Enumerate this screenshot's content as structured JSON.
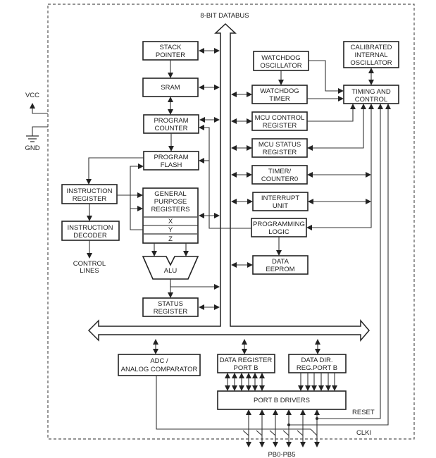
{
  "diagram": {
    "databus_label": "8-BIT DATABUS",
    "power": {
      "vcc": "VCC",
      "gnd": "GND"
    },
    "blocks": {
      "stack_pointer": [
        "STACK",
        "POINTER"
      ],
      "sram": [
        "SRAM"
      ],
      "program_counter": [
        "PROGRAM",
        "COUNTER"
      ],
      "program_flash": [
        "PROGRAM",
        "FLASH"
      ],
      "instruction_register": [
        "INSTRUCTION",
        "REGISTER"
      ],
      "instruction_decoder": [
        "INSTRUCTION",
        "DECODER"
      ],
      "control_lines": [
        "CONTROL",
        "LINES"
      ],
      "gp_registers": [
        "GENERAL",
        "PURPOSE",
        "REGISTERS"
      ],
      "gp_sub": [
        "X",
        "Y",
        "Z"
      ],
      "alu": "ALU",
      "status_register": [
        "STATUS",
        "REGISTER"
      ],
      "watchdog_oscillator": [
        "WATCHDOG",
        "OSCILLATOR"
      ],
      "watchdog_timer": [
        "WATCHDOG",
        "TIMER"
      ],
      "mcu_control_register": [
        "MCU CONTROL",
        "REGISTER"
      ],
      "mcu_status_register": [
        "MCU STATUS",
        "REGISTER"
      ],
      "timer_counter0": [
        "TIMER/",
        "COUNTER0"
      ],
      "interrupt_unit": [
        "INTERRUPT",
        "UNIT"
      ],
      "programming_logic": [
        "PROGRAMMING",
        "LOGIC"
      ],
      "data_eeprom": [
        "DATA",
        "EEPROM"
      ],
      "calibrated_oscillator": [
        "CALIBRATED",
        "INTERNAL",
        "OSCILLATOR"
      ],
      "timing_control": [
        "TIMING AND",
        "CONTROL"
      ],
      "adc": [
        "ADC /",
        "ANALOG COMPARATOR"
      ],
      "data_register_port_b": [
        "DATA REGISTER",
        "PORT B"
      ],
      "data_dir_port_b": [
        "DATA DIR.",
        "REG.PORT B"
      ],
      "port_b_drivers": [
        "PORT B DRIVERS"
      ]
    },
    "signals": {
      "reset": "RESET",
      "clki": "CLKI",
      "pins": "PB0-PB5"
    }
  }
}
